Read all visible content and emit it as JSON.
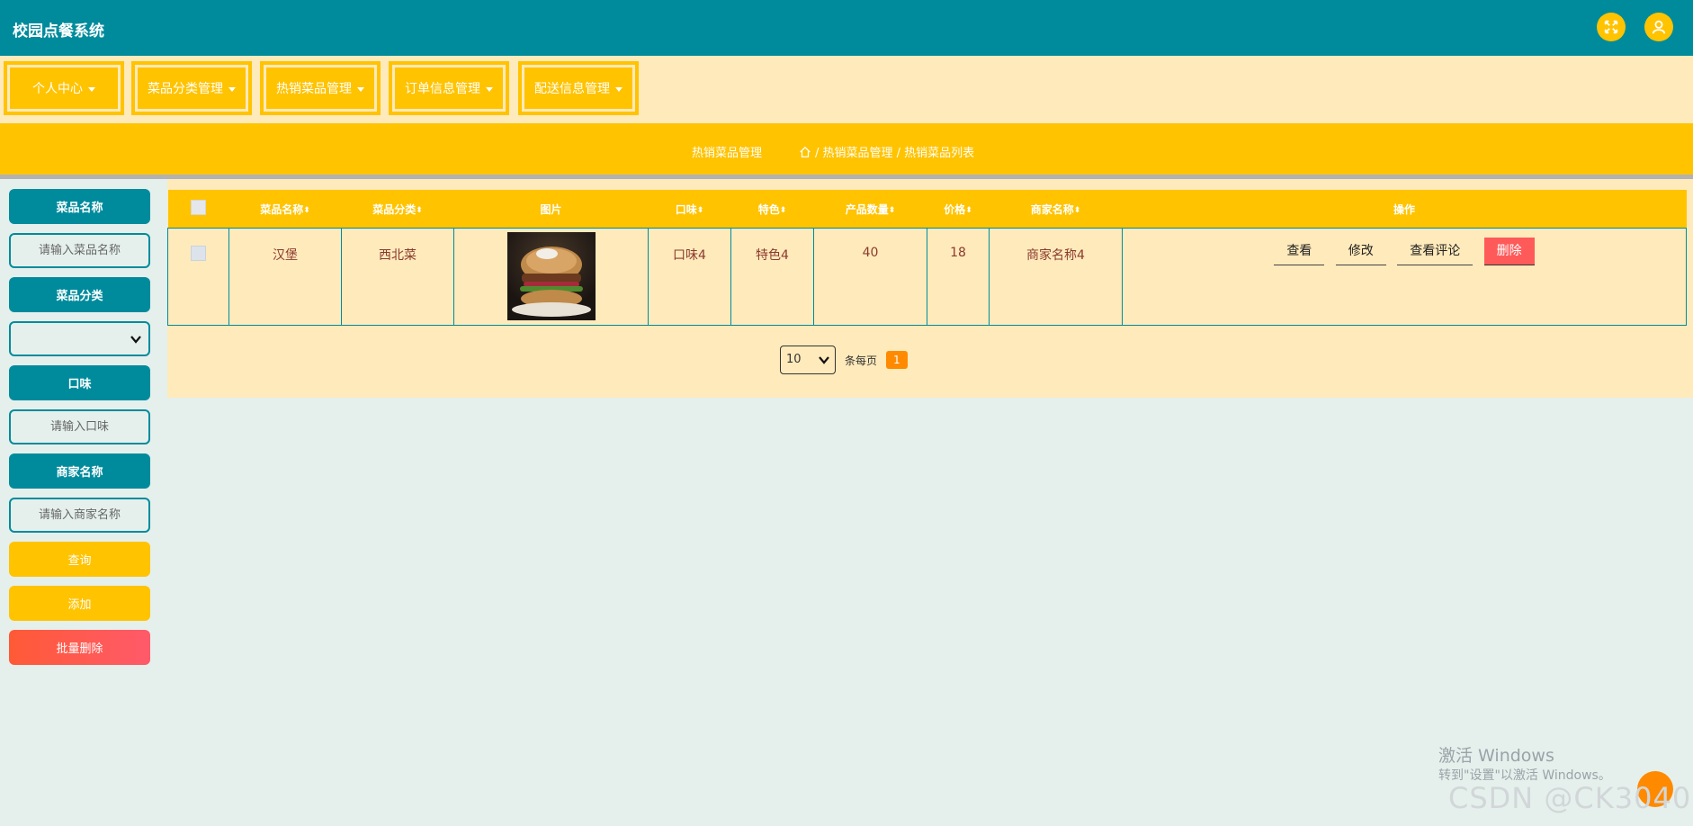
{
  "app": {
    "title": "校园点餐系统"
  },
  "colors": {
    "primary": "#008b9c",
    "accent": "#ffc300",
    "panel": "#ffeabb",
    "danger": "#ff5a5a",
    "orange": "#ff8a00"
  },
  "header_icons": [
    "fullscreen-icon",
    "user-icon"
  ],
  "nav": {
    "items": [
      {
        "label": "个人中心"
      },
      {
        "label": "菜品分类管理"
      },
      {
        "label": "热销菜品管理"
      },
      {
        "label": "订单信息管理"
      },
      {
        "label": "配送信息管理"
      }
    ]
  },
  "breadcrumb": {
    "title": "热销菜品管理",
    "path": "/ 热销菜品管理 / 热销菜品列表"
  },
  "search": {
    "name_label": "菜品名称",
    "name_placeholder": "请输入菜品名称",
    "category_label": "菜品分类",
    "category_value": "",
    "taste_label": "口味",
    "taste_placeholder": "请输入口味",
    "merchant_label": "商家名称",
    "merchant_placeholder": "请输入商家名称",
    "query_button": "查询",
    "add_button": "添加",
    "batch_delete_button": "批量删除"
  },
  "table": {
    "headers": [
      "",
      "菜品名称",
      "菜品分类",
      "图片",
      "口味",
      "特色",
      "产品数量",
      "价格",
      "商家名称",
      "操作"
    ],
    "sortable": [
      false,
      true,
      true,
      false,
      true,
      true,
      true,
      true,
      true,
      false
    ],
    "rows": [
      {
        "name": "汉堡",
        "category": "西北菜",
        "image": "burger-photo",
        "taste": "口味4",
        "feature": "特色4",
        "quantity": "40",
        "price": "18",
        "merchant": "商家名称4"
      }
    ],
    "actions": {
      "view": "查看",
      "edit": "修改",
      "comments": "查看评论",
      "delete": "删除"
    }
  },
  "pagination": {
    "page_size": "10",
    "per_page_label": "条每页",
    "current_page": "1"
  },
  "watermark": {
    "line1": "激活 Windows",
    "line2": "转到\"设置\"以激活 Windows。",
    "csdn": "CSDN @CK3040"
  }
}
